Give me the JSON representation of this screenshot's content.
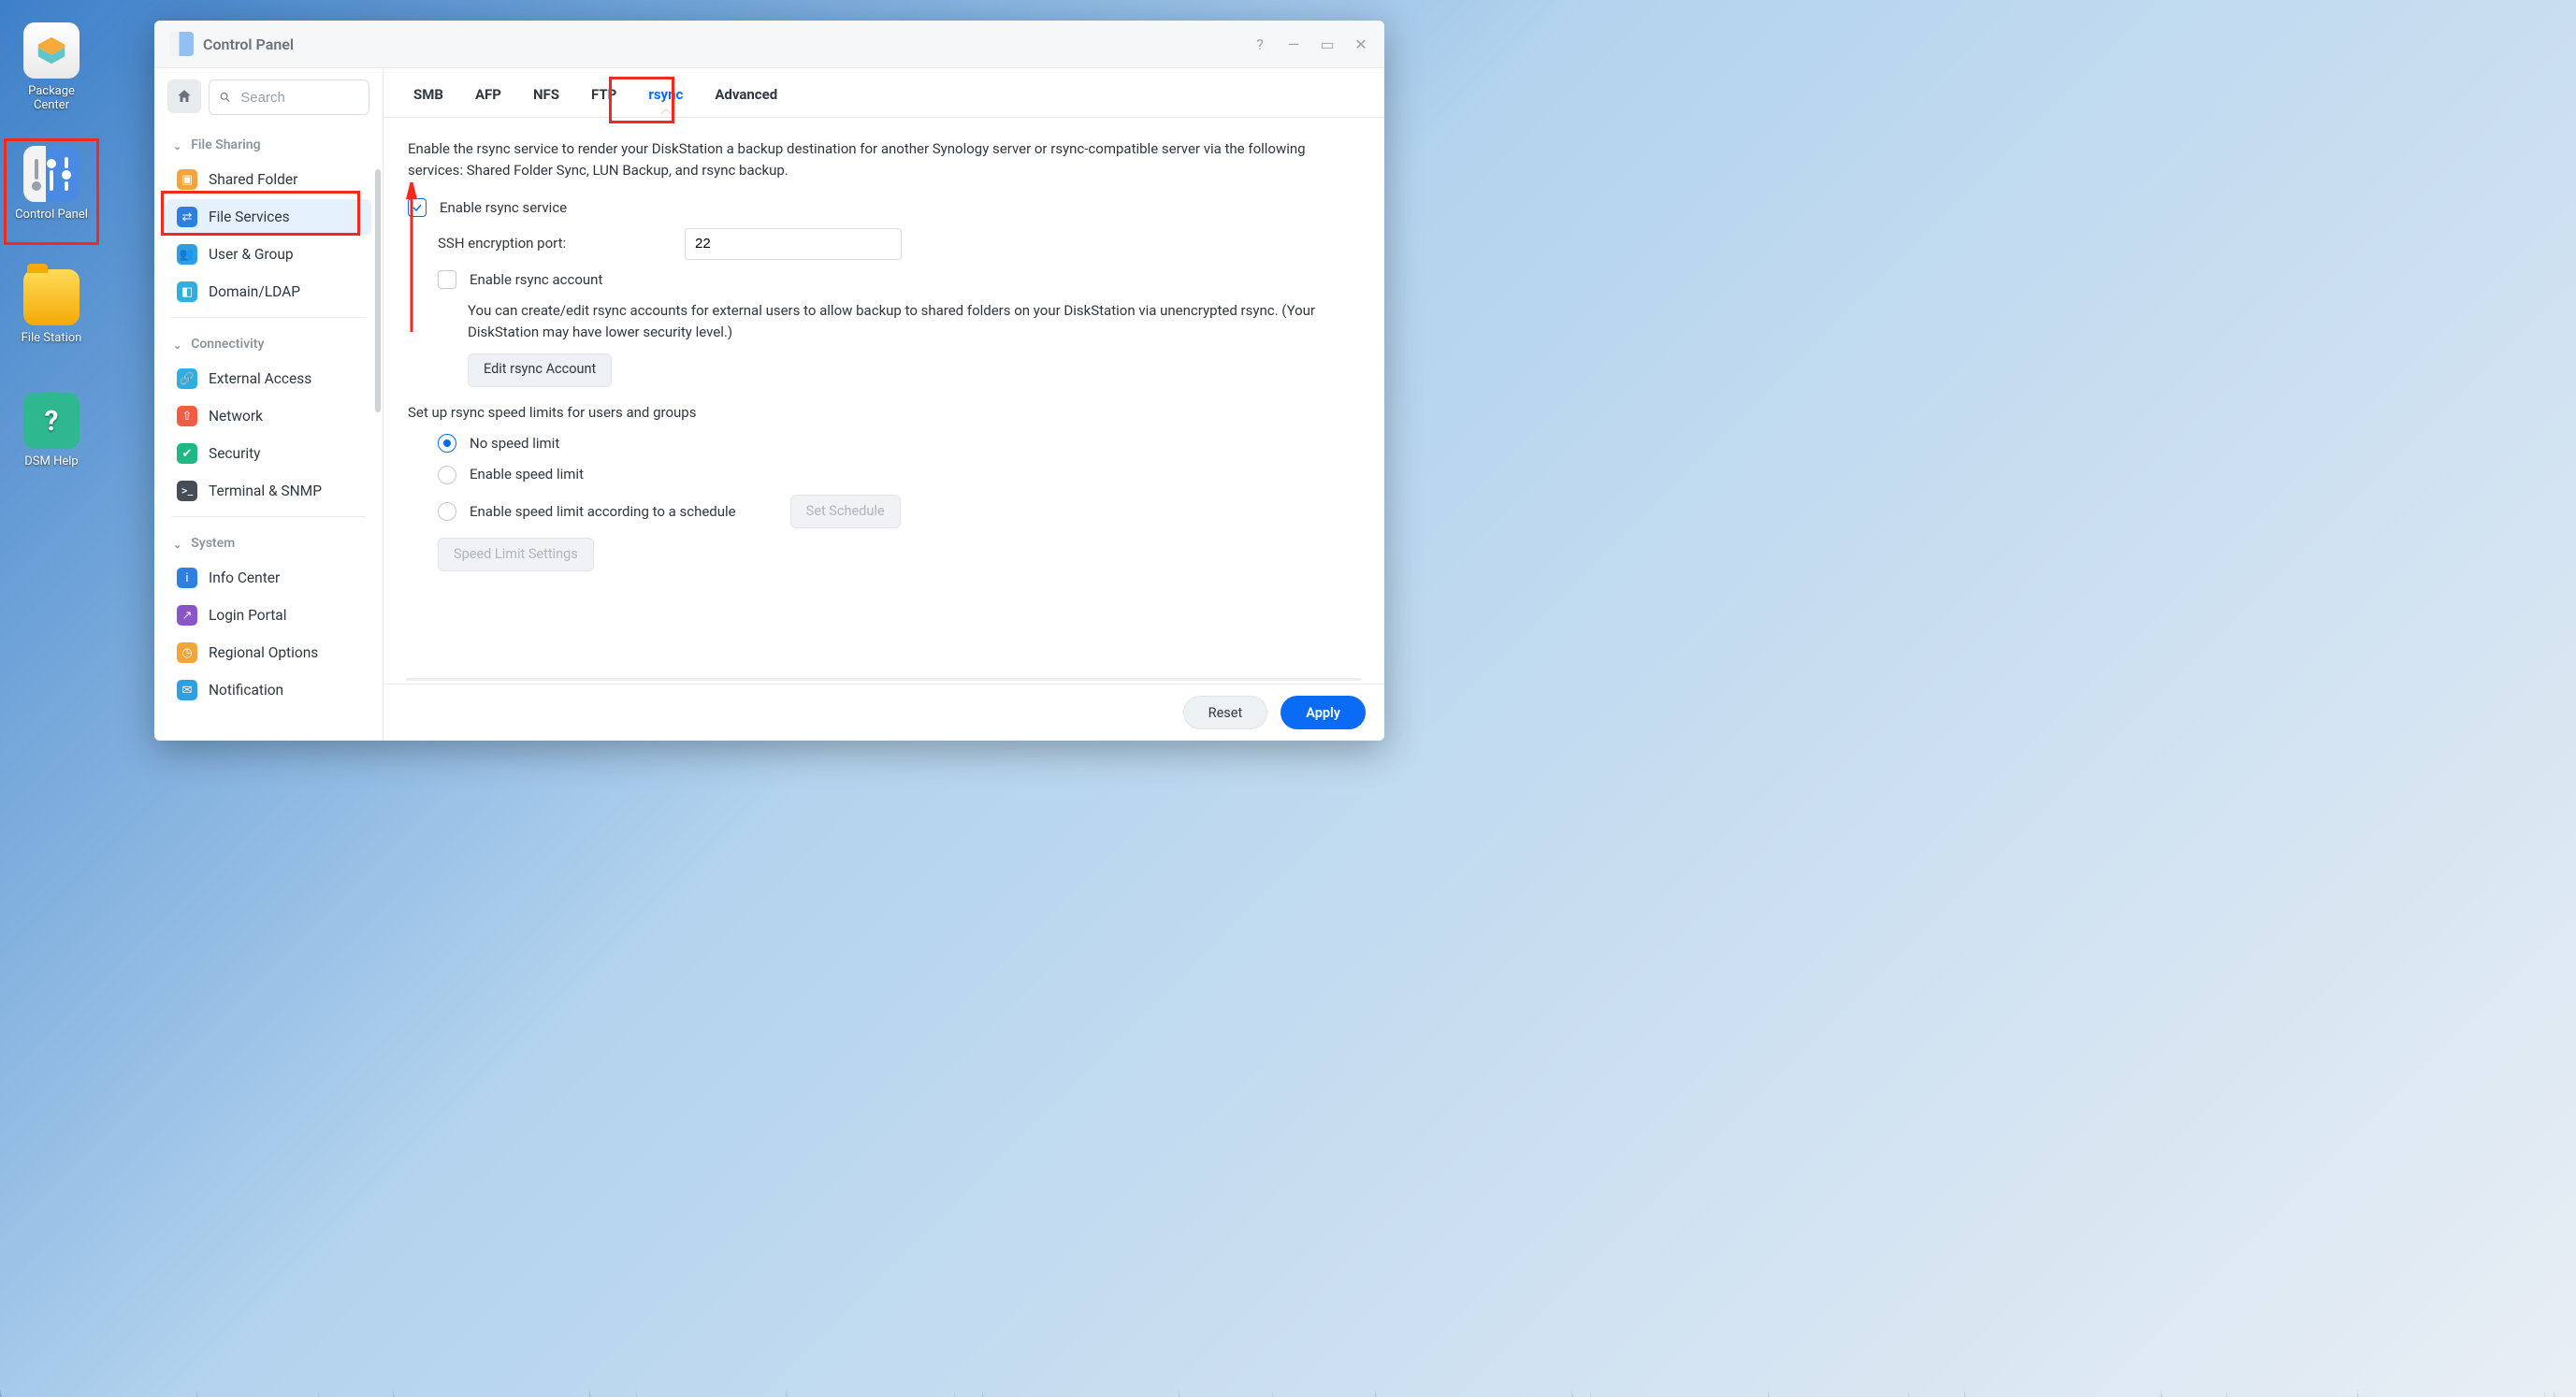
{
  "desktop": {
    "icons": [
      {
        "name": "package-center",
        "label": "Package Center"
      },
      {
        "name": "control-panel",
        "label": "Control Panel"
      },
      {
        "name": "file-station",
        "label": "File Station"
      },
      {
        "name": "dsm-help",
        "label": "DSM Help"
      }
    ]
  },
  "window": {
    "title": "Control Panel",
    "search_placeholder": "Search",
    "sidebar": {
      "sections": [
        {
          "title": "File Sharing",
          "items": [
            {
              "id": "shared-folder",
              "label": "Shared Folder"
            },
            {
              "id": "file-services",
              "label": "File Services",
              "active": true
            },
            {
              "id": "user-group",
              "label": "User & Group"
            },
            {
              "id": "domain-ldap",
              "label": "Domain/LDAP"
            }
          ]
        },
        {
          "title": "Connectivity",
          "items": [
            {
              "id": "external-access",
              "label": "External Access"
            },
            {
              "id": "network",
              "label": "Network"
            },
            {
              "id": "security",
              "label": "Security"
            },
            {
              "id": "terminal-snmp",
              "label": "Terminal & SNMP"
            }
          ]
        },
        {
          "title": "System",
          "items": [
            {
              "id": "info-center",
              "label": "Info Center"
            },
            {
              "id": "login-portal",
              "label": "Login Portal"
            },
            {
              "id": "regional-options",
              "label": "Regional Options"
            },
            {
              "id": "notification",
              "label": "Notification"
            }
          ]
        }
      ]
    },
    "tabs": [
      {
        "id": "smb",
        "label": "SMB"
      },
      {
        "id": "afp",
        "label": "AFP"
      },
      {
        "id": "nfs",
        "label": "NFS"
      },
      {
        "id": "ftp",
        "label": "FTP"
      },
      {
        "id": "rsync",
        "label": "rsync",
        "active": true
      },
      {
        "id": "advanced",
        "label": "Advanced"
      }
    ],
    "rsync": {
      "description": "Enable the rsync service to render your DiskStation a backup destination for another Synology server or rsync-compatible server via the following services: Shared Folder Sync, LUN Backup, and rsync backup.",
      "enable_label": "Enable rsync service",
      "enable_checked": true,
      "ssh_port_label": "SSH encryption port:",
      "ssh_port_value": "22",
      "enable_account_label": "Enable rsync account",
      "enable_account_checked": false,
      "account_note": "You can create/edit rsync accounts for external users to allow backup to shared folders on your DiskStation via unencrypted rsync. (Your DiskStation may have lower security level.)",
      "edit_account_btn": "Edit rsync Account",
      "speed_heading": "Set up rsync speed limits for users and groups",
      "speed_options": [
        {
          "id": "no-limit",
          "label": "No speed limit",
          "selected": true
        },
        {
          "id": "enable-limit",
          "label": "Enable speed limit",
          "selected": false
        },
        {
          "id": "schedule-limit",
          "label": "Enable speed limit according to a schedule",
          "selected": false
        }
      ],
      "set_schedule_btn": "Set Schedule",
      "speed_settings_btn": "Speed Limit Settings"
    },
    "footer": {
      "reset": "Reset",
      "apply": "Apply"
    }
  }
}
